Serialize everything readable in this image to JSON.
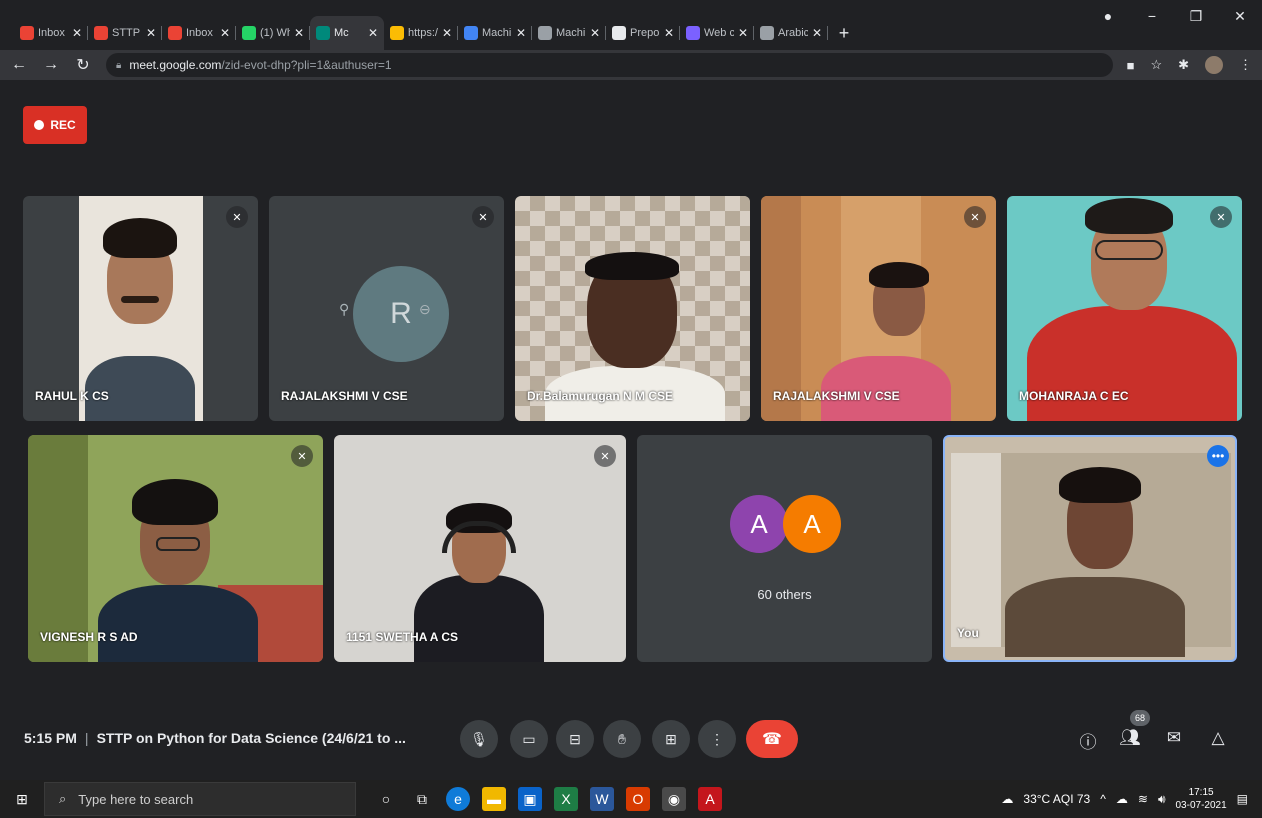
{
  "browser": {
    "tabs": [
      {
        "title": "Inbox",
        "icon": "gmail-icon",
        "color": "#ea4335"
      },
      {
        "title": "STTP c",
        "icon": "gmail-icon",
        "color": "#ea4335"
      },
      {
        "title": "Inbox",
        "icon": "gmail-icon",
        "color": "#ea4335"
      },
      {
        "title": "(1) Wh",
        "icon": "whatsapp-icon",
        "color": "#25d366"
      },
      {
        "title": "Mc",
        "icon": "meet-icon",
        "color": "#00897b",
        "active": true
      },
      {
        "title": "https:/",
        "icon": "page-icon",
        "color": "#fbbc04"
      },
      {
        "title": "Machi",
        "icon": "google-icon",
        "color": "#4285f4"
      },
      {
        "title": "Machi",
        "icon": "doc-icon",
        "color": "#9aa0a6"
      },
      {
        "title": "Prepo",
        "icon": "n-icon",
        "color": "#e8eaed"
      },
      {
        "title": "Web c",
        "icon": "web-icon",
        "color": "#7b61ff"
      },
      {
        "title": "Arabic",
        "icon": "doc-icon",
        "color": "#9aa0a6"
      }
    ],
    "new_tab": "+",
    "url_host": "meet.google.com",
    "url_path": "/zid-evot-dhp?pli=1&authuser=1"
  },
  "rec": {
    "label": "REC"
  },
  "participants": [
    {
      "name": "RAHUL K CS"
    },
    {
      "name": "RAJALAKSHMI V CSE",
      "initial": "R"
    },
    {
      "name": "Dr.Balamurugan N M CSE"
    },
    {
      "name": "RAJALAKSHMI V CSE"
    },
    {
      "name": "MOHANRAJA C EC"
    },
    {
      "name": "VIGNESH R S AD"
    },
    {
      "name": "1151 SWETHA A CS"
    },
    {
      "name": "You"
    }
  ],
  "others": {
    "avatars": [
      "A",
      "A"
    ],
    "label": "60 others",
    "colors": [
      "#8e44ad",
      "#f57c00"
    ]
  },
  "meeting": {
    "time": "5:15 PM",
    "title": "STTP on Python for Data Science (24/6/21 to ...",
    "participant_count": "68"
  },
  "taskbar": {
    "search_placeholder": "Type here to search",
    "weather": "33°C  AQI 73",
    "time": "17:15",
    "date": "03-07-2021"
  }
}
